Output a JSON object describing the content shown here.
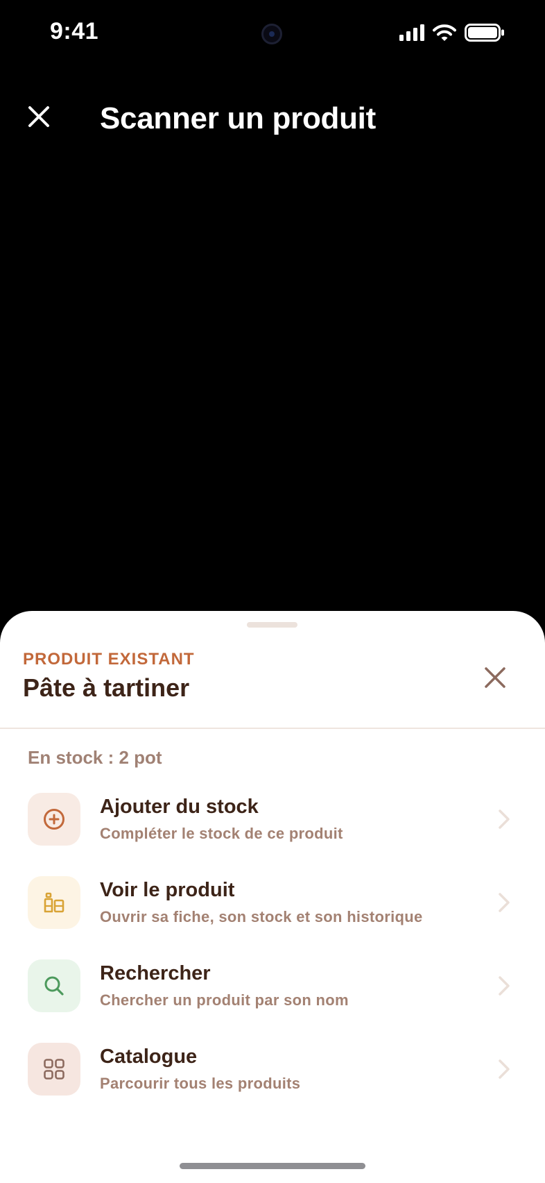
{
  "status_bar": {
    "time": "9:41",
    "icons": [
      "cellular-signal-icon",
      "wifi-icon",
      "battery-icon"
    ]
  },
  "header": {
    "title": "Scanner un produit",
    "close_icon": "close-icon"
  },
  "sheet": {
    "eyebrow": "PRODUIT EXISTANT",
    "title": "Pâte à tartiner",
    "close_icon": "close-icon",
    "stock_text": "En stock : 2 pot",
    "actions": [
      {
        "title": "Ajouter du stock",
        "subtitle": "Compléter le stock de ce produit",
        "icon": "add-circle-icon",
        "icon_color": "#c2683a",
        "icon_bg": "#f8ebe4"
      },
      {
        "title": "Voir le produit",
        "subtitle": "Ouvrir sa fiche, son stock et son historique",
        "icon": "jars-icon",
        "icon_color": "#d9a335",
        "icon_bg": "#fdf4e4"
      },
      {
        "title": "Rechercher",
        "subtitle": "Chercher un produit par son nom",
        "icon": "search-icon",
        "icon_color": "#4d9a5d",
        "icon_bg": "#e9f5ea"
      },
      {
        "title": "Catalogue",
        "subtitle": "Parcourir tous les produits",
        "icon": "grid-icon",
        "icon_color": "#8c6a5e",
        "icon_bg": "#f6e6e0"
      }
    ]
  },
  "colors": {
    "accent": "#c2683a",
    "text_dark": "#3d2418",
    "text_muted": "#a38172",
    "chevron": "#eadfd8"
  }
}
